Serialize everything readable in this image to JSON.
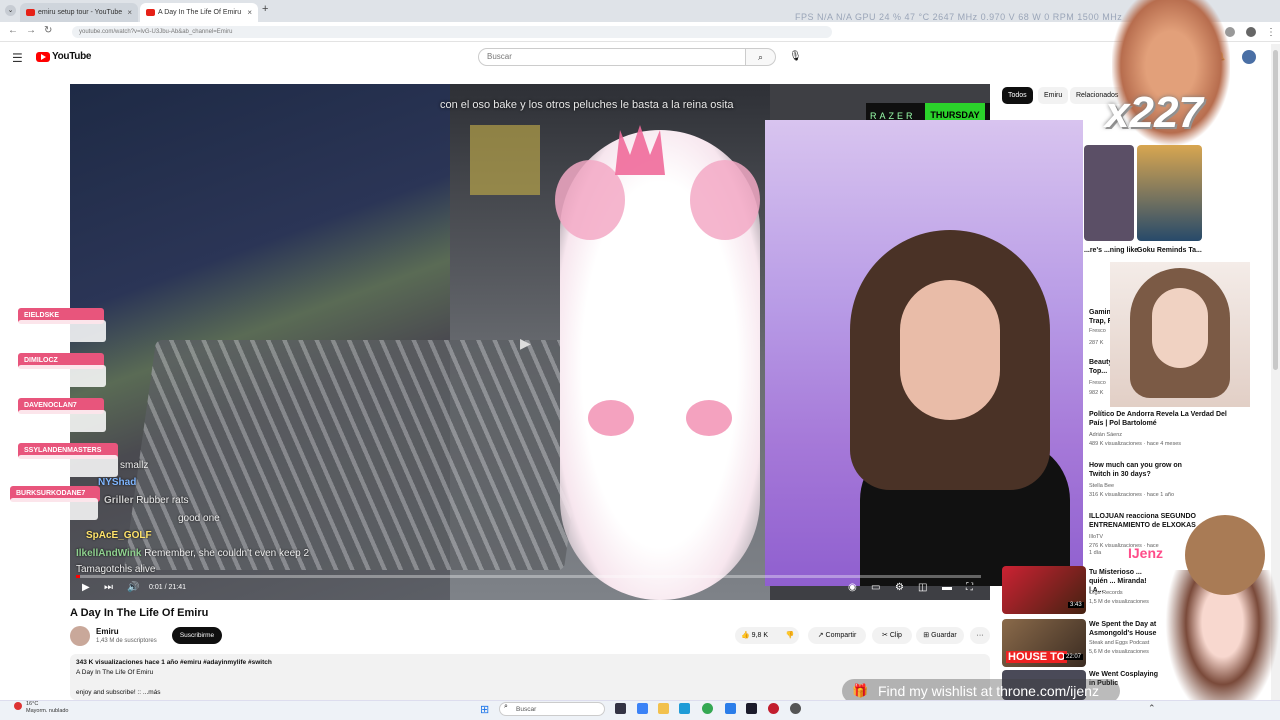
{
  "browser": {
    "tabs": [
      {
        "label": "emiru setup tour - YouTube",
        "close": "×"
      },
      {
        "label": "A Day In The Life Of Emiru",
        "close": "×"
      }
    ],
    "new_tab": "+",
    "menu": "⌄",
    "url": "youtube.com/watch?v=lvG-U3Jbu-Ab&ab_channel=Emiru",
    "perf_overlay": "FPS  N/A  N/A       GPU  24 %  47 °C  2647 MHz  0.970 V  68 W  0 RPM  1500 MHz"
  },
  "youtube": {
    "logo_text": "YouTube",
    "search_placeholder": "Buscar"
  },
  "video": {
    "overlay_caption": "con el oso bake y los otros peluches le basta a la reina osita",
    "razer_text": "RAZER",
    "thursday_text": "THURSDAY",
    "time": "0:01 / 21:41",
    "progress": 0.001,
    "chat_badges": [
      "EIELDSKE",
      "DIMILOCZ",
      "DAVENOCLAN7",
      "SSYLANDENMASTERS",
      "BURKSURKODANE7"
    ],
    "chat_lines": [
      {
        "user": "",
        "text": "smallz"
      },
      {
        "user": "NYShad",
        "text": ""
      },
      {
        "user": "Griller",
        "text": "Rubber rats"
      },
      {
        "user": "",
        "text": "good one"
      },
      {
        "user": "SpAcE_GOLF",
        "text": ""
      },
      {
        "user": "IlkellAndWink",
        "text": "Remember, she couldn't even keep 2"
      },
      {
        "user": "",
        "text": "Tamagotchis alive"
      }
    ]
  },
  "details": {
    "title": "A Day In The Life Of Emiru",
    "channel": "Emiru",
    "subscribers": "1,43 M de suscriptores",
    "subscribe": "Suscribirme",
    "likes": "9,8 K",
    "share": "Compartir",
    "clip": "Clip",
    "save": "Guardar",
    "more": "···",
    "views_line": "343 K visualizaciones  hace 1 año  #emiru #adayinmylife #switch",
    "desc_line1": "A Day In The Life Of Emiru",
    "desc_line2": "enjoy and subscribe! :: ...más"
  },
  "sidebar": {
    "chips": [
      "Todos",
      "Emiru",
      "Relacionados"
    ],
    "shorts": [
      {
        "title": "...re's ...ning like"
      },
      {
        "title": "Goku Reminds Ta..."
      }
    ],
    "recommendations": [
      {
        "title": "Gamin... Trap, F...",
        "channel": "Fresco",
        "meta": "287 K"
      },
      {
        "title": "Beauty... Top...",
        "channel": "Fresco",
        "meta": "982 K"
      },
      {
        "title": "Político De Andorra Revela La Verdad Del País | Pol Bartolomé",
        "channel": "Adrián Sáenz",
        "meta": "489 K visualizaciones · hace 4 meses"
      },
      {
        "title": "How much can you grow on Twitch in 30 days?",
        "channel": "Stella Bee",
        "meta": "316 K visualizaciones · hace 1 año"
      },
      {
        "title": "ILLOJUAN reacciona SEGUNDO ENTRENAMIENTO de ELXOKAS",
        "channel": "IlloTV",
        "meta": "276 K visualizaciones · hace 1 día"
      },
      {
        "title": "Tu Misterioso ... quién ... Miranda! | A...",
        "channel": "Olga Records",
        "meta": "1,5 M de visualizaciones"
      },
      {
        "title": "We Spent the Day at Asmongold's House",
        "channel": "Steak and Eggs Podcast",
        "meta": "5,6 M de visualizaciones"
      },
      {
        "title": "We Went Cosplaying in Public",
        "channel": "",
        "meta": ""
      }
    ],
    "thumb_labels": [
      "3:43",
      "HOUSE TO",
      "22:07"
    ]
  },
  "overlays": {
    "meme_count": "x227",
    "jenz": "IJenz",
    "wishlist": "Find my wishlist at throne.com/ijenz"
  },
  "taskbar": {
    "weather_temp": "16°C",
    "weather_desc": "Mayorm. nublado",
    "search": "Buscar"
  }
}
